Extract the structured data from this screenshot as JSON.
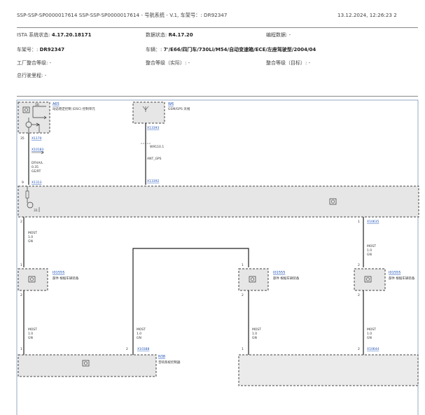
{
  "header": {
    "title": "SSP-SSP-SP0000017614 SSP-SSP-SP0000017614 - 号航系统 - V.1, 车架号：: DR92347",
    "timestamp": "13.12.2024, 12:26:23 2"
  },
  "info": {
    "ista_label": "ISTA 系统状态: ",
    "ista_value": "4.17.20.18171",
    "data_label": "数据状态: ",
    "data_value": "R4.17.20",
    "prog_label": "编程数据: -",
    "vin_label": "车架号：: ",
    "vin_value": "DR92347",
    "model_label": "车辆：: ",
    "model_value": "7'/E66/四门车/730Li/M54/自动变速箱/ECE/左座驾驶型/2004/04",
    "factory_label": "工厂整合等级: -",
    "actual_label": "整合等级（实际）: -",
    "target_label": "整合等级（目标）: -",
    "mileage_label": "总行驶里程: -"
  },
  "diagram": {
    "a65_id": "A65",
    "a65_desc": "动态稳定控制 (DSC) 控制单元",
    "a65_pin": "16",
    "w6_id": "W6",
    "w6_desc": "GSM/GPS 天线",
    "x1170": "X1170",
    "pin35": "35",
    "x10183": "X10183",
    "wire_a_1": "DFHA/L",
    "wire_a_2": "0.35",
    "wire_a_3": "GE/RT",
    "x13393": "X13393",
    "w9110": "W9110.1",
    "ant_gps": "ANT_GPS",
    "pin9": "9",
    "x1313": "X1313",
    "x13392": "X13392",
    "pin31": "31",
    "pin2_a": "2",
    "pin1_b": "1",
    "x10635": "X10635",
    "most": "MOST",
    "size": "1.0",
    "gn": "GN",
    "i01555": "I01555",
    "i01555_desc": "部件 根据车辆装备",
    "pin1": "1",
    "pin2": "2",
    "x10388": "X10388",
    "n38": "N38",
    "n38_desc": "音响系统控制器",
    "x10644": "X10644"
  }
}
